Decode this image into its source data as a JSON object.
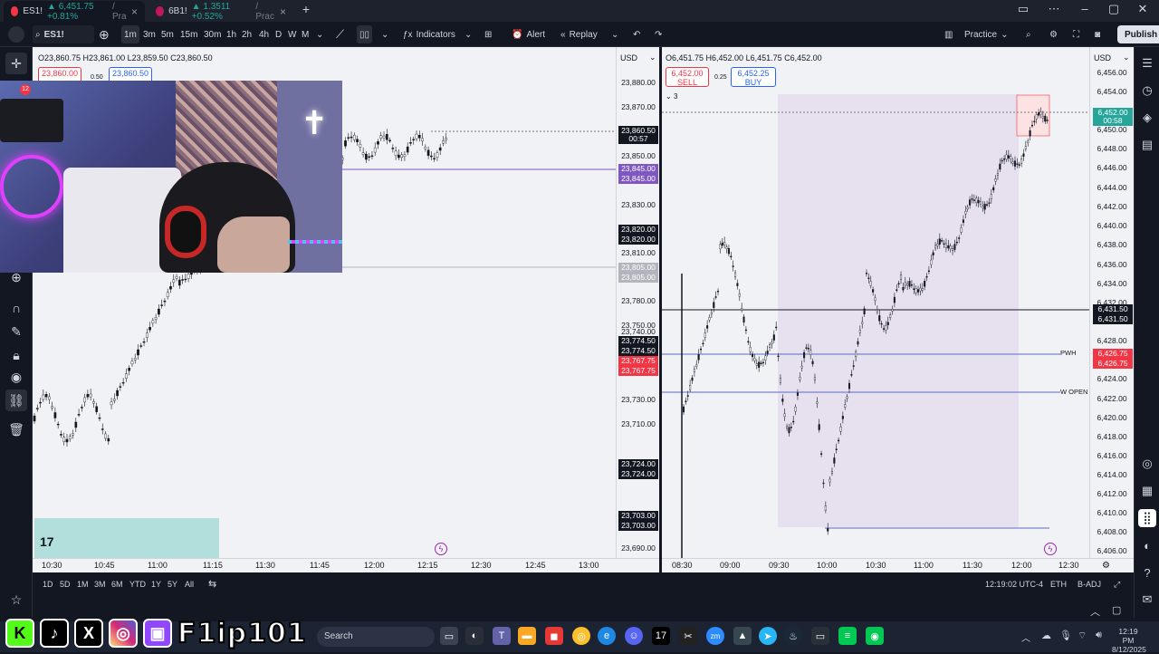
{
  "tabs": [
    {
      "symbol": "ES1!",
      "price": "6,451.75",
      "change": "+0.81%",
      "suffix": "/ Pra",
      "active": true
    },
    {
      "symbol": "6B1!",
      "price": "1.3511",
      "change": "+0.52%",
      "suffix": "/ Prac",
      "active": false
    }
  ],
  "toolbar": {
    "symbol": "ES1!",
    "intervals": [
      "1m",
      "3m",
      "5m",
      "15m",
      "30m",
      "1h",
      "2h",
      "4h",
      "D",
      "W",
      "M"
    ],
    "selected_interval": "1m",
    "indicators": "Indicators",
    "alert": "Alert",
    "replay": "Replay",
    "practice": "Practice",
    "publish": "Publish"
  },
  "left_chart": {
    "ohlc": "O23,860.75  H23,861.00  L23,859.50  C23,860.50",
    "sell_price": "23,860.00",
    "buy_price": "23,860.50",
    "spread": "0.50",
    "currency": "USD",
    "y_ticks": [
      "23,880.00",
      "23,870.00",
      "23,850.00",
      "23,830.00",
      "23,810.00",
      "23,790.00",
      "23,780.00",
      "23,750.00",
      "23,740.00",
      "23,730.00",
      "23,710.00",
      "23,690.00"
    ],
    "tags": [
      {
        "text": "23,860.50",
        "color": "#131722"
      },
      {
        "text": "00:57",
        "color": "#131722"
      },
      {
        "text": "23,845.00",
        "color": "#7e57c2"
      },
      {
        "text": "23,845.00",
        "color": "#7e57c2"
      },
      {
        "text": "23,820.00",
        "color": "#131722"
      },
      {
        "text": "23,820.00",
        "color": "#131722"
      },
      {
        "text": "23,805.00",
        "color": "#b2b5be"
      },
      {
        "text": "23,805.00",
        "color": "#b2b5be"
      },
      {
        "text": "23,774.50",
        "color": "#131722"
      },
      {
        "text": "23,774.50",
        "color": "#131722"
      },
      {
        "text": "23,767.75",
        "color": "#f23645"
      },
      {
        "text": "23,767.75",
        "color": "#f23645"
      },
      {
        "text": "23,724.00",
        "color": "#131722"
      },
      {
        "text": "23,724.00",
        "color": "#131722"
      },
      {
        "text": "23,703.00",
        "color": "#131722"
      },
      {
        "text": "23,703.00",
        "color": "#131722"
      }
    ],
    "x_ticks": [
      "10:30",
      "10:45",
      "11:00",
      "11:15",
      "11:30",
      "11:45",
      "12:00",
      "12:15",
      "12:30",
      "12:45",
      "13:00"
    ],
    "logo": "17"
  },
  "right_chart": {
    "ohlc": "O6,451.75  H6,452.00  L6,451.75  C6,452.00",
    "sell_price": "6,452.00",
    "sell_label": "SELL",
    "buy_price": "6,452.25",
    "buy_label": "BUY",
    "spread": "0.25",
    "currency": "USD",
    "indicator_count": "3",
    "y_ticks": [
      "6,456.00",
      "6,454.00",
      "6,450.00",
      "6,448.00",
      "6,446.00",
      "6,444.00",
      "6,442.00",
      "6,440.00",
      "6,438.00",
      "6,436.00",
      "6,434.00",
      "6,432.00",
      "6,428.00",
      "6,424.00",
      "6,422.00",
      "6,420.00",
      "6,418.00",
      "6,416.00",
      "6,414.00",
      "6,412.00",
      "6,410.00",
      "6,408.00",
      "6,406.00"
    ],
    "tags": [
      {
        "text": "6,452.00",
        "color": "#26a69a"
      },
      {
        "text": "00:58",
        "color": "#26a69a"
      },
      {
        "text": "6,431.50",
        "color": "#131722"
      },
      {
        "text": "6,431.50",
        "color": "#131722"
      },
      {
        "text": "6,426.75",
        "color": "#f23645"
      },
      {
        "text": "6,426.75",
        "color": "#f23645"
      }
    ],
    "level_labels": [
      "PWH",
      "W OPEN"
    ],
    "x_ticks": [
      "08:30",
      "09:00",
      "09:30",
      "10:00",
      "10:30",
      "11:00",
      "11:30",
      "12:00",
      "12:30"
    ]
  },
  "bottom": {
    "ranges": [
      "1D",
      "5D",
      "1M",
      "3M",
      "6M",
      "YTD",
      "1Y",
      "5Y",
      "All"
    ],
    "clock": "12:19:02 UTC-4",
    "session": "ETH",
    "adj": "B-ADJ"
  },
  "taskbar": {
    "search": "Search",
    "time": "12:19 PM",
    "date": "8/12/2025"
  },
  "overlay": {
    "handle": "F1ip101"
  }
}
